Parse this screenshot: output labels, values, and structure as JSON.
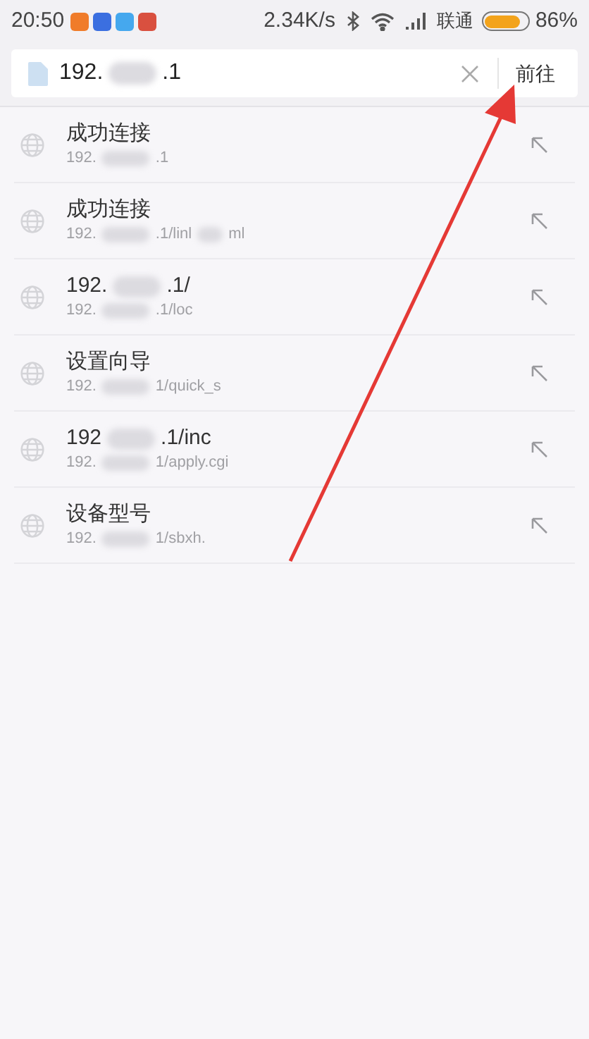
{
  "status_bar": {
    "time": "20:50",
    "app_icons": [
      {
        "color": "#f07c2a"
      },
      {
        "color": "#3b6fe0"
      },
      {
        "color": "#45a8ee"
      },
      {
        "color": "#d9503f"
      }
    ],
    "speed": "2.34K/s",
    "carrier": "联通",
    "battery": {
      "level": 0.86,
      "reading": "86%"
    }
  },
  "address_bar": {
    "value_parts": [
      "192.",
      ".1"
    ],
    "go_button": "前往"
  },
  "history": [
    {
      "title_parts": [
        "成功连接"
      ],
      "url_parts": [
        "192.",
        ".1"
      ]
    },
    {
      "title_parts": [
        "成功连接"
      ],
      "url_parts": [
        "192.",
        ".1/linl",
        "ml"
      ]
    },
    {
      "title_parts": [
        "192.",
        ".1/"
      ],
      "url_parts": [
        "192.",
        ".1/loc"
      ]
    },
    {
      "title_parts": [
        "设置向导"
      ],
      "url_parts": [
        "192.",
        "1/quick_s"
      ]
    },
    {
      "title_parts": [
        "192",
        ".1/inc"
      ],
      "url_parts": [
        "192.",
        "1/apply.cgi"
      ]
    },
    {
      "title_parts": [
        "设备型号"
      ],
      "url_parts": [
        "192.",
        "1/sbxh."
      ]
    }
  ]
}
